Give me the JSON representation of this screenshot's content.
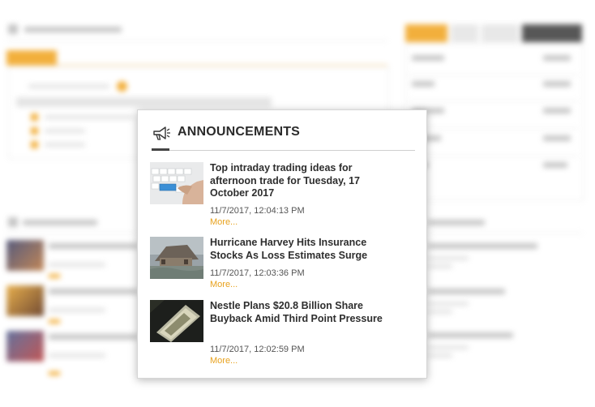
{
  "popup": {
    "title": "ANNOUNCEMENTS",
    "icon": "megaphone-icon",
    "items": [
      {
        "title": "Top intraday trading ideas for afternoon trade for Tuesday, 17 October 2017",
        "time": "11/7/2017, 12:04:13 PM",
        "more": "More...",
        "thumb": "keyboard-photo"
      },
      {
        "title": "Hurricane Harvey Hits Insurance Stocks As Loss Estimates Surge",
        "time": "11/7/2017, 12:03:36 PM",
        "more": "More...",
        "thumb": "flooded-house-photo"
      },
      {
        "title": "Nestle Plans $20.8 Billion Share Buyback Amid Third Point Pressure",
        "time": "11/7/2017, 12:02:59 PM",
        "more": "More...",
        "thumb": "nestle-sign-photo"
      }
    ]
  },
  "colors": {
    "accent": "#f0a21b",
    "link": "#e8a21e",
    "title_text": "#2b2b2b"
  }
}
